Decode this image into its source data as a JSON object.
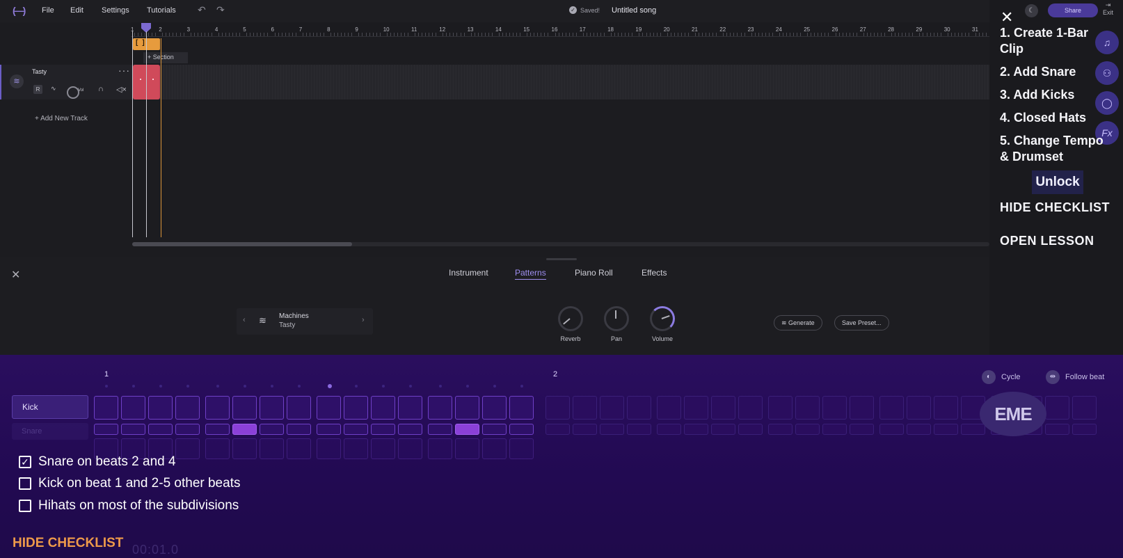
{
  "topbar": {
    "logo": "(—)",
    "menu": [
      "File",
      "Edit",
      "Settings",
      "Tutorials"
    ],
    "undo_icon": "undo-icon",
    "redo_icon": "redo-icon",
    "saved_label": "Saved!",
    "song_title": "Untitled song",
    "share_label": "Share",
    "exit_label": "Exit"
  },
  "ruler": {
    "bars": [
      1,
      2,
      3,
      4,
      5,
      6,
      7,
      8,
      9,
      10,
      11,
      12,
      13,
      14,
      15,
      16,
      17,
      18,
      19,
      20,
      21,
      22,
      23,
      24,
      25,
      26,
      27,
      28,
      29,
      30,
      31
    ]
  },
  "arrangement": {
    "section_label": "Section",
    "track": {
      "name": "Tasty",
      "r_label": "R",
      "vol_label": "Vol"
    },
    "add_track_label": "Add New Track"
  },
  "panel": {
    "tabs": [
      "Instrument",
      "Patterns",
      "Piano Roll",
      "Effects"
    ],
    "active_tab": "Patterns",
    "instrument": {
      "category": "Machines",
      "name": "Tasty"
    },
    "knobs": [
      "Reverb",
      "Pan",
      "Volume"
    ],
    "generate_label": "Generate",
    "save_preset_label": "Save Preset..."
  },
  "sequencer": {
    "bar_labels": [
      "1",
      "2"
    ],
    "rows": [
      "Kick",
      "Snare"
    ],
    "cycle_label": "Cycle",
    "follow_beat_label": "Follow beat",
    "watermark": "EME",
    "snare_on_steps": [
      5,
      13
    ],
    "active_beat_dot": 8
  },
  "checklist": {
    "items": [
      {
        "label": "Snare on beats 2 and 4",
        "checked": true
      },
      {
        "label": "Kick on beat 1 and 2-5 other beats",
        "checked": false
      },
      {
        "label": "Hihats on most of the subdivisions",
        "checked": false
      }
    ],
    "hide_label": "HIDE CHECKLIST",
    "transport_time": "00:01.0"
  },
  "lesson": {
    "steps": [
      "1. Create 1-Bar Clip",
      "2. Add Snare",
      "3. Add Kicks",
      "4. Closed Hats",
      "5. Change Tempo & Drumset"
    ],
    "unlock_label": "Unlock",
    "hide_checklist_label": "HIDE CHECKLIST",
    "open_lesson_label": "OPEN LESSON"
  },
  "colors": {
    "accent": "#9f8ff0",
    "clip": "#d04a5a",
    "loop": "#e79b3d",
    "sequencer_bg": "#2a0e5e",
    "step_on": "#8b40d8",
    "hide_checklist": "#ee9a4a"
  }
}
